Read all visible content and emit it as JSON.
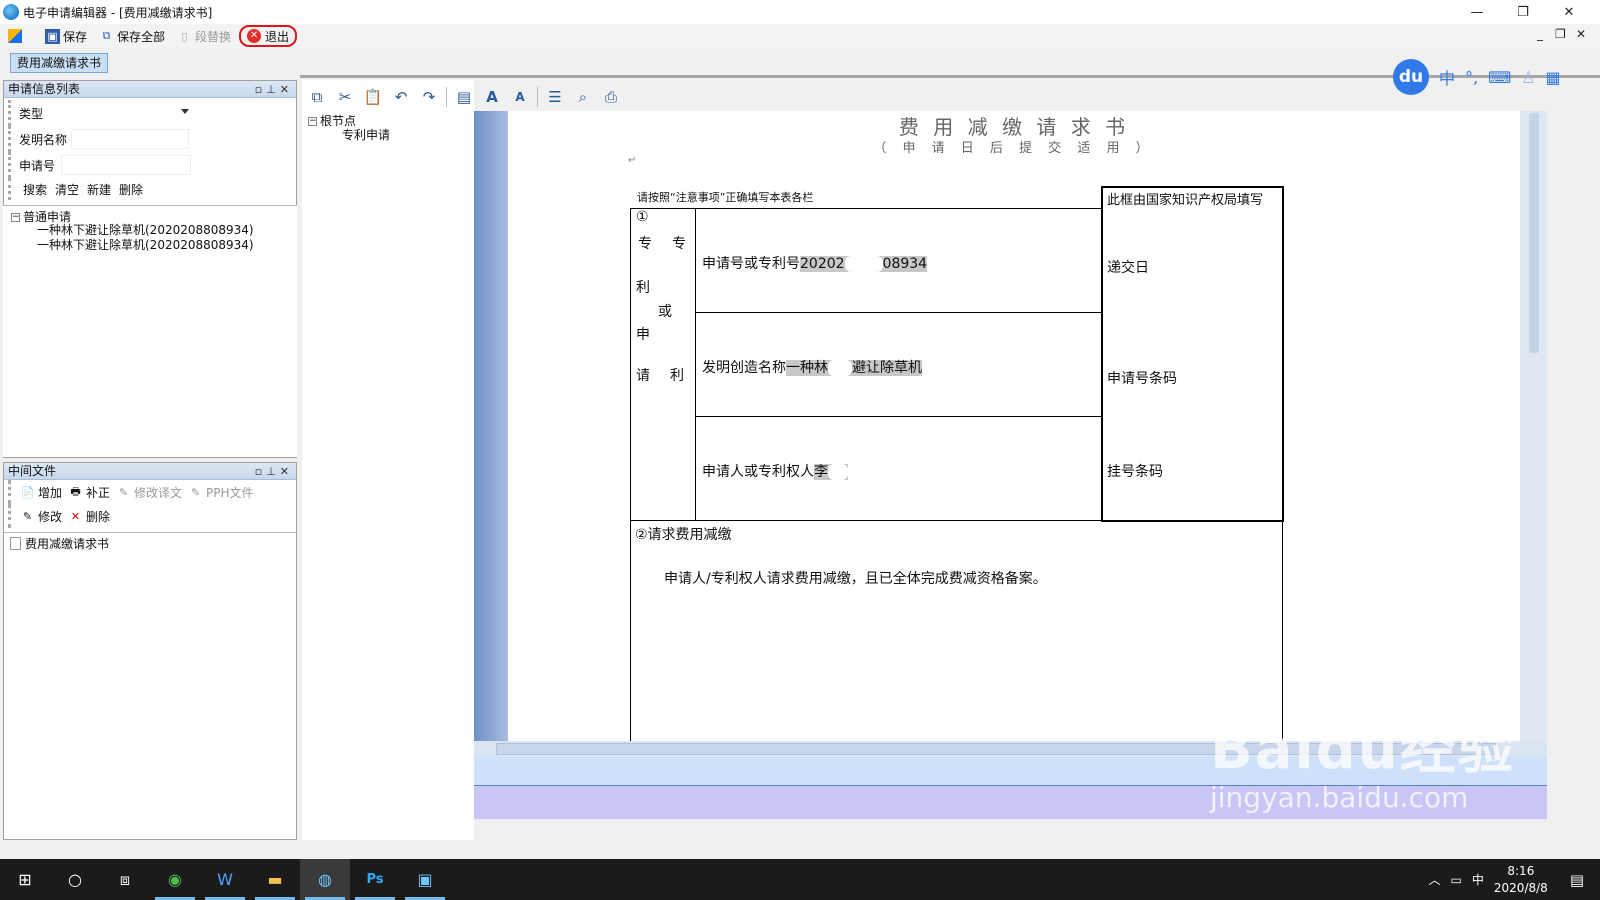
{
  "window": {
    "title": "电子申请编辑器 - [费用减缴请求书]",
    "controls": {
      "minimize": "—",
      "maximize": "❐",
      "close": "✕"
    }
  },
  "toolbar": {
    "save": "保存",
    "save_all": "保存全部",
    "replace": "段替换",
    "exit": "退出"
  },
  "mdi_controls": {
    "minimize": "_",
    "restore": "❐",
    "close": "✕"
  },
  "tab": {
    "label": "费用减缴请求书"
  },
  "info_panel": {
    "title": "申请信息列表",
    "type_label": "类型",
    "invention_label": "发明名称",
    "app_no_label": "申请号",
    "actions": [
      "搜索",
      "清空",
      "新建",
      "删除"
    ],
    "tree": {
      "root": "普通申请",
      "items": [
        "一种林下避让除草机(2020208808934)",
        "一种林下避让除草机(2020208808934)"
      ]
    }
  },
  "middle_panel": {
    "title": "中间文件",
    "buttons_row1": [
      "增加",
      "补正",
      "修改译文",
      "PPH文件"
    ],
    "buttons_row2": [
      "修改",
      "删除"
    ],
    "files": [
      "费用减缴请求书"
    ]
  },
  "node_tree": {
    "root": "根节点",
    "child": "专利申请"
  },
  "ime": {
    "logo": "du",
    "lang": "中"
  },
  "document": {
    "title": "费 用 减 缴 请 求 书",
    "subtitle": "（ 申 请 日 后 提 交 适 用 ）",
    "note": "请按照“注意事项”正确填写本表各栏",
    "office_box_title": "此框由国家知识产权局填写",
    "left_col": [
      "①",
      "专",
      "专",
      "利",
      "或",
      "申",
      "请",
      "利"
    ],
    "app_no_label": "申请号或专利号",
    "app_no_value_a": "20202",
    "app_no_value_b": "08934",
    "name_label": "发明创造名称",
    "name_value_a": "一种林",
    "name_value_b": "避让除草机",
    "applicant_label": "申请人或专利权人",
    "applicant_value_a": "李",
    "applicant_value_b": "",
    "submit_date": "递交日",
    "barcode": "申请号条码",
    "reg_code": "挂号条码",
    "section2_title": "②请求费用减缴",
    "section2_text": "申请人/专利权人请求费用减缴，且已全体完成费减资格备案。"
  },
  "taskbar": {
    "time": "8:16",
    "date": "2020/8/8",
    "ime": "中"
  },
  "watermark": {
    "brand": "Baidu经验",
    "url": "jingyan.baidu.com"
  }
}
